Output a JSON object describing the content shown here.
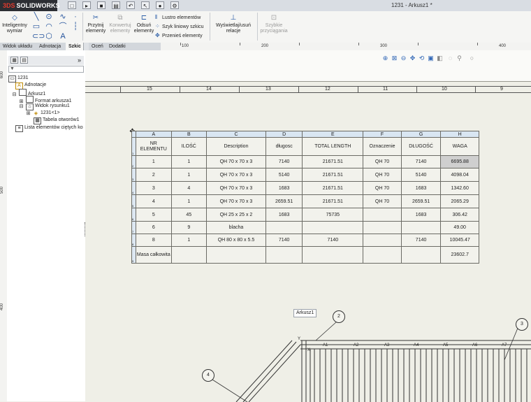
{
  "app": {
    "logo_text": "SOLIDWORKS",
    "logo_prefix": "3DS",
    "document_title": "1231 - Arkusz1 *",
    "accent": "#2d5fa8",
    "logo_bg": "#2c2e33"
  },
  "ribbon": {
    "smart_dimension": "Inteligentny wymiar",
    "trim": "Przytnij elementy",
    "convert": "Konwertuj elementy",
    "offset": "Odsuń elementy",
    "mirror": "Lustro elementów",
    "linear_pattern": "Szyk liniowy szkicu",
    "move": "Przenieś elementy",
    "display_delete": "Wyświetlaj/usuń relacje",
    "rapid_snaps": "Szybkie przyciągania"
  },
  "command_tabs": [
    "Widok układu",
    "Adnotacja",
    "Szkic",
    "Oceń",
    "Dodatki SOLIDWORKS"
  ],
  "active_tab": "Szkic",
  "ruler": {
    "top_numbers": [
      "100",
      "200",
      "300",
      "400"
    ],
    "left_numbers": [
      "600",
      "500",
      "400"
    ]
  },
  "feature_tree": {
    "expand_label": "»",
    "items": [
      {
        "label": "1231",
        "icon": "drawing-icon"
      },
      {
        "label": "Adnotacje",
        "icon": "annotations-icon"
      },
      {
        "label": "Arkusz1",
        "icon": "sheet-icon"
      },
      {
        "label": "Format arkusza1",
        "icon": "sheet-format-icon"
      },
      {
        "label": "Widok rysunku1",
        "icon": "drawing-view-icon"
      },
      {
        "label": "1231<1>",
        "icon": "part-icon"
      },
      {
        "label": "Tabela otworów1",
        "icon": "table-icon"
      },
      {
        "label": "Lista elementów ciętych ko",
        "icon": "cutlist-icon"
      }
    ]
  },
  "sheet_zones": [
    "15",
    "14",
    "13",
    "12",
    "11",
    "10",
    "9"
  ],
  "bom": {
    "col_letters": [
      "A",
      "B",
      "C",
      "D",
      "E",
      "F",
      "G",
      "H"
    ],
    "headers": [
      "NR ELEMENTU",
      "ILOŚĆ",
      "Description",
      "długosc",
      "TOTAL LENGTH",
      "Oznaczenie",
      "DŁUGOŚĆ",
      "WAGA"
    ],
    "rows": [
      [
        "1",
        "1",
        "QH 70 x 70 x 3",
        "7140",
        "21671.51",
        "QH 70",
        "7140",
        "6695.88"
      ],
      [
        "2",
        "1",
        "QH 70 x 70 x 3",
        "5140",
        "21671.51",
        "QH 70",
        "5140",
        "4098.04"
      ],
      [
        "3",
        "4",
        "QH 70 x 70 x 3",
        "1683",
        "21671.51",
        "QH 70",
        "1683",
        "1342.60"
      ],
      [
        "4",
        "1",
        "QH 70 x 70 x 3",
        "2659.51",
        "21671.51",
        "QH 70",
        "2659.51",
        "2065.29"
      ],
      [
        "5",
        "45",
        "QH 25 x 25 x 2",
        "1683",
        "75735",
        "",
        "1683",
        "306.42"
      ],
      [
        "6",
        "9",
        "blacha",
        "",
        "",
        "",
        "",
        "49.00"
      ],
      [
        "8",
        "1",
        "QH 80 x 80 x 5.5",
        "7140",
        "7140",
        "",
        "7140",
        "10045.47"
      ]
    ],
    "total_label": "Masa całkowita",
    "total_value": "23602.7",
    "row_numbers": [
      "1",
      "2",
      "3",
      "4",
      "5",
      "6",
      "7",
      "8",
      "9"
    ]
  },
  "balloons": [
    "2",
    "3",
    "4"
  ],
  "sheet_tooltip": "Arkusz1",
  "grid_labels": [
    "A1",
    "A2",
    "A3",
    "A4",
    "A5",
    "A6",
    "A7"
  ],
  "corner_marks": [
    "Y",
    "X"
  ]
}
